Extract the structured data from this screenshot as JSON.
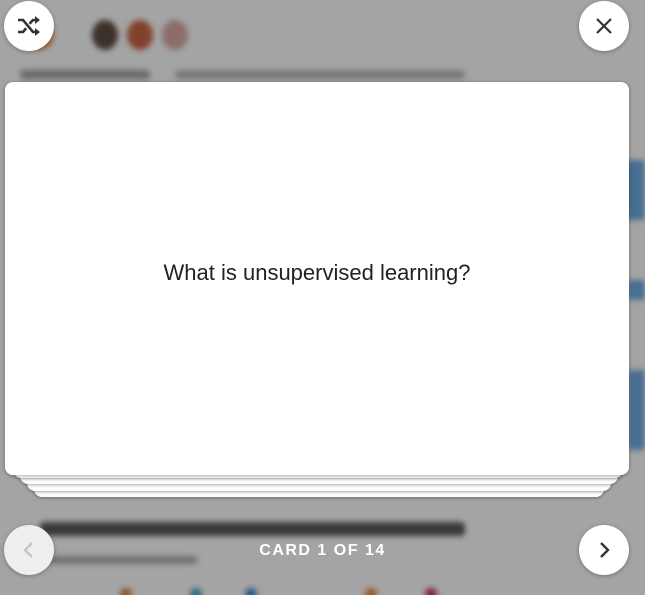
{
  "flashcard": {
    "question": "What is unsupervised learning?",
    "counter": "CARD 1 OF 14"
  },
  "controls": {
    "shuffle_icon": "shuffle-icon",
    "close_icon": "close-icon",
    "prev_icon": "chevron-left-icon",
    "next_icon": "chevron-right-icon"
  },
  "colors": {
    "overlay": "#000000",
    "card": "#ffffff",
    "counter_text": "#ffffff"
  }
}
